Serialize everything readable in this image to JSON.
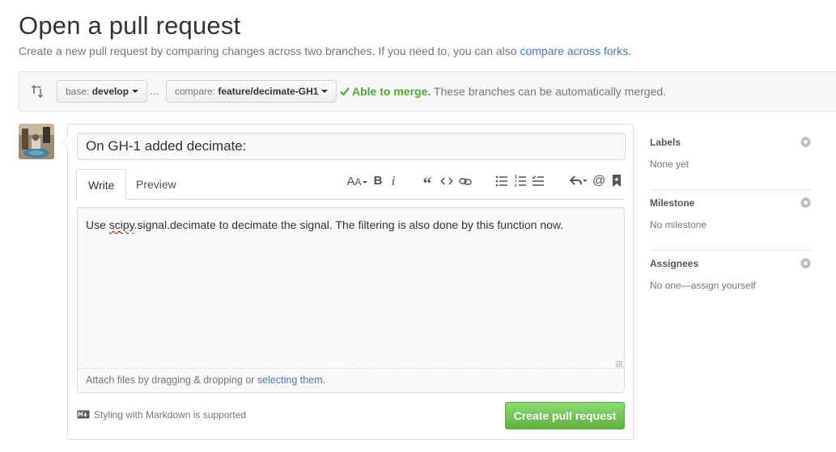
{
  "header": {
    "title": "Open a pull request",
    "subtitle_text": "Create a new pull request by comparing changes across two branches. If you need to, you can also",
    "subtitle_link": "compare across forks."
  },
  "range": {
    "base_label": "base:",
    "base_branch": "develop",
    "separator": "...",
    "compare_label": "compare:",
    "compare_branch": "feature/decimate-GH1",
    "merge_ok": "Able to merge.",
    "merge_text": "These branches can be automatically merged."
  },
  "form": {
    "title_value": "On GH-1 added decimate:",
    "tabs": [
      "Write",
      "Preview"
    ],
    "toolbar_icons": [
      "text-size-icon",
      "bold-icon",
      "italic-icon",
      "quote-icon",
      "code-icon",
      "link-icon",
      "bulleted-list-icon",
      "numbered-list-icon",
      "task-list-icon",
      "reply-icon",
      "mention-icon",
      "bookmark-icon"
    ],
    "body_prefix": "Use ",
    "body_misspelled": "scipy",
    "body_rest": ".signal.decimate to decimate the signal. The filtering is also done by this function now.",
    "attach_text": "Attach files by dragging & dropping or",
    "attach_link": "selecting them.",
    "markdown_note": "Styling with Markdown is supported",
    "submit_label": "Create pull request"
  },
  "sidebar": {
    "sections": [
      {
        "heading": "Labels",
        "value": "None yet"
      },
      {
        "heading": "Milestone",
        "value": "No milestone"
      },
      {
        "heading": "Assignees",
        "value": "No one—assign yourself"
      }
    ]
  },
  "colors": {
    "link": "#4078c0",
    "success": "#55a532",
    "button_green": "#60b044"
  }
}
